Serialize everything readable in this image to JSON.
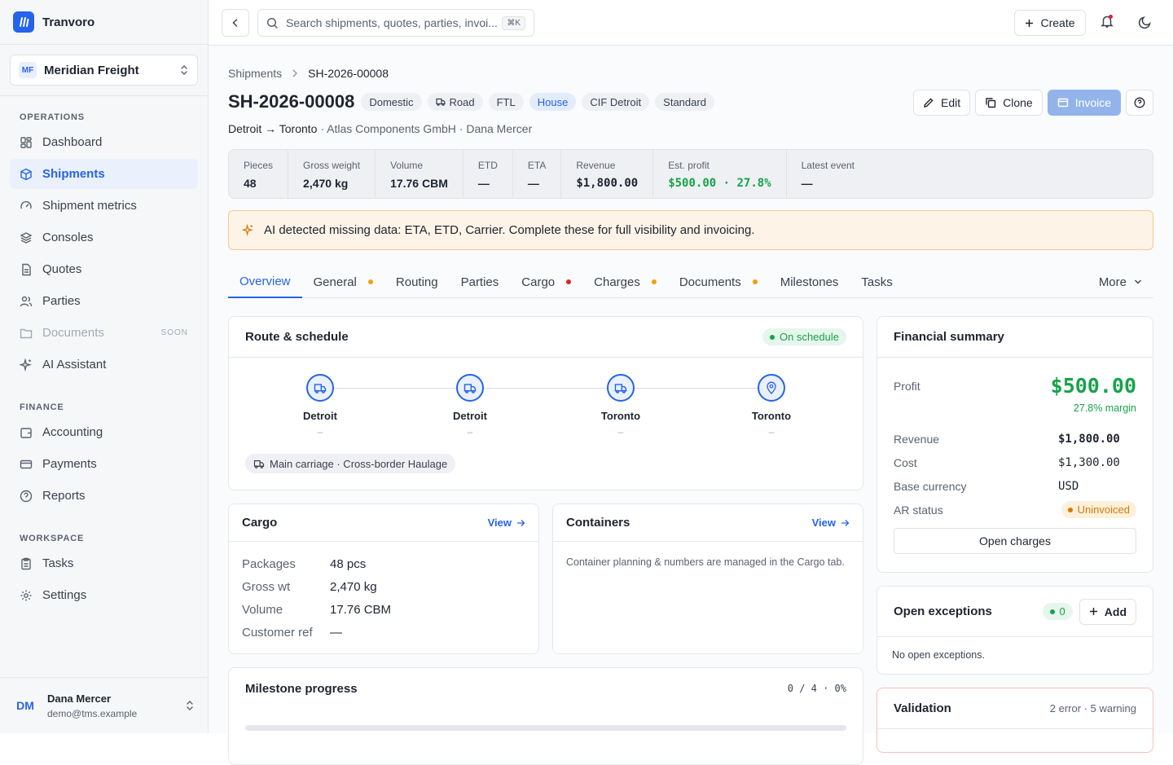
{
  "app": {
    "name": "Tranvoro",
    "brand_color": "#2563eb"
  },
  "org": {
    "initials": "MF",
    "name": "Meridian Freight"
  },
  "sidebar": {
    "sections": [
      {
        "title": "OPERATIONS",
        "items": [
          {
            "label": "Dashboard",
            "icon": "dashboard-icon"
          },
          {
            "label": "Shipments",
            "icon": "box-icon",
            "active": true
          },
          {
            "label": "Shipment metrics",
            "icon": "gauge-icon"
          },
          {
            "label": "Consoles",
            "icon": "layers-icon"
          },
          {
            "label": "Quotes",
            "icon": "file-icon"
          },
          {
            "label": "Parties",
            "icon": "users-icon"
          },
          {
            "label": "Documents",
            "icon": "folder-icon",
            "badge": "SOON",
            "disabled": true
          },
          {
            "label": "AI Assistant",
            "icon": "sparkles-icon"
          }
        ]
      },
      {
        "title": "FINANCE",
        "items": [
          {
            "label": "Accounting",
            "icon": "wallet-icon"
          },
          {
            "label": "Payments",
            "icon": "credit-card-icon"
          },
          {
            "label": "Reports",
            "icon": "help-circle-icon"
          }
        ]
      },
      {
        "title": "WORKSPACE",
        "items": [
          {
            "label": "Tasks",
            "icon": "clipboard-icon"
          },
          {
            "label": "Settings",
            "icon": "gear-icon"
          }
        ]
      }
    ]
  },
  "user": {
    "initials": "DM",
    "name": "Dana Mercer",
    "email": "demo@tms.example"
  },
  "topbar": {
    "search_placeholder": "Search shipments, quotes, parties, invoi...",
    "shortcut": "⌘K",
    "create_label": "Create"
  },
  "breadcrumb": {
    "parent": "Shipments",
    "current": "SH-2026-00008"
  },
  "shipment": {
    "id": "SH-2026-00008",
    "chips": [
      "Domestic",
      "Road",
      "FTL",
      "House",
      "CIF Detroit",
      "Standard"
    ],
    "route_label": "Detroit → Toronto",
    "customer": "Atlas Components GmbH",
    "owner": "Dana Mercer"
  },
  "actions": {
    "edit": "Edit",
    "clone": "Clone",
    "invoice": "Invoice"
  },
  "stats": [
    {
      "label": "Pieces",
      "value": "48"
    },
    {
      "label": "Gross weight",
      "value": "2,470 kg"
    },
    {
      "label": "Volume",
      "value": "17.76 CBM"
    },
    {
      "label": "ETD",
      "value": "—"
    },
    {
      "label": "ETA",
      "value": "—"
    },
    {
      "label": "Revenue",
      "value": "$1,800.00",
      "mono": true
    },
    {
      "label": "Est. profit",
      "value": "$500.00 · 27.8%",
      "mono": true,
      "green": true
    },
    {
      "label": "Latest event",
      "value": "—"
    }
  ],
  "alert": {
    "text": "AI detected missing data: ETA, ETD, Carrier. Complete these for full visibility and invoicing."
  },
  "tabs": [
    {
      "label": "Overview",
      "active": true
    },
    {
      "label": "General",
      "dot": "#f59e0b"
    },
    {
      "label": "Routing"
    },
    {
      "label": "Parties"
    },
    {
      "label": "Cargo",
      "dot": "#dc2626"
    },
    {
      "label": "Charges",
      "dot": "#f59e0b"
    },
    {
      "label": "Documents",
      "dot": "#f59e0b"
    },
    {
      "label": "Milestones"
    },
    {
      "label": "Tasks"
    }
  ],
  "tabs_more": "More",
  "route_card": {
    "title": "Route & schedule",
    "status": "On schedule",
    "stops": [
      {
        "name": "Detroit",
        "time": "–",
        "icon": "truck-icon"
      },
      {
        "name": "Detroit",
        "time": "–",
        "icon": "truck-icon"
      },
      {
        "name": "Toronto",
        "time": "–",
        "icon": "truck-icon"
      },
      {
        "name": "Toronto",
        "time": "–",
        "icon": "map-pin-icon"
      }
    ],
    "leg": "Main carriage · Cross-border Haulage"
  },
  "cargo_card": {
    "title": "Cargo",
    "view": "View",
    "rows": [
      {
        "k": "Packages",
        "v": "48 pcs"
      },
      {
        "k": "Gross wt",
        "v": "2,470 kg"
      },
      {
        "k": "Volume",
        "v": "17.76 CBM"
      },
      {
        "k": "Customer ref",
        "v": "—"
      }
    ]
  },
  "containers_card": {
    "title": "Containers",
    "view": "View",
    "text": "Container planning & numbers are managed in the Cargo tab."
  },
  "milestone_card": {
    "title": "Milestone progress",
    "progress": "0 / 4 · 0%",
    "fraction": 0
  },
  "financial": {
    "title": "Financial summary",
    "profit_label": "Profit",
    "profit": "$500.00",
    "margin": "27.8% margin",
    "rows": [
      {
        "k": "Revenue",
        "v": "$1,800.00",
        "bold": true
      },
      {
        "k": "Cost",
        "v": "$1,300.00"
      },
      {
        "k": "Base currency",
        "v": "USD"
      }
    ],
    "ar_label": "AR status",
    "ar_status": "Uninvoiced",
    "open_charges": "Open charges"
  },
  "exceptions": {
    "title": "Open exceptions",
    "count": "0",
    "add": "Add",
    "empty": "No open exceptions."
  },
  "validation": {
    "title": "Validation",
    "summary": "2 error · 5 warning"
  }
}
